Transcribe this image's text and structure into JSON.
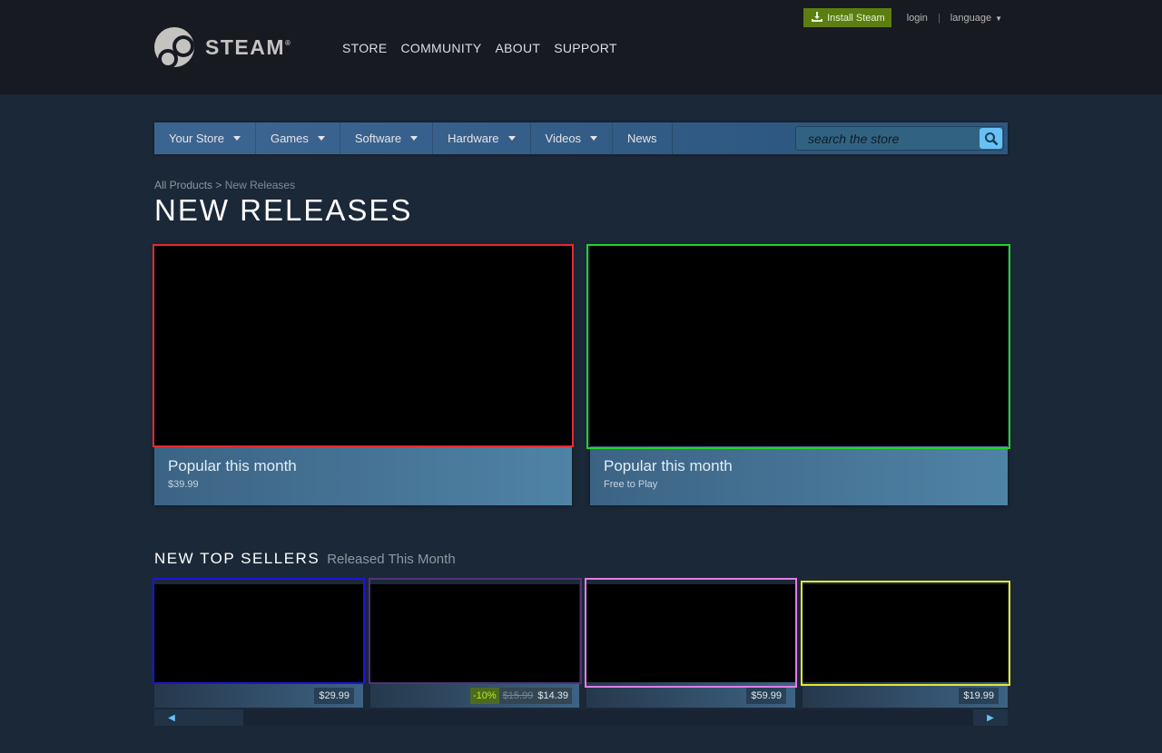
{
  "header": {
    "logo_text": "STEAM",
    "logo_reg": "®",
    "nav": [
      "STORE",
      "COMMUNITY",
      "ABOUT",
      "SUPPORT"
    ],
    "install_label": "Install Steam",
    "login_label": "login",
    "separator": "|",
    "language_label": "language"
  },
  "store_nav": {
    "tabs": [
      {
        "label": "Your Store"
      },
      {
        "label": "Games"
      },
      {
        "label": "Software"
      },
      {
        "label": "Hardware"
      },
      {
        "label": "Videos"
      },
      {
        "label": "News"
      }
    ],
    "search_placeholder": "search the store"
  },
  "breadcrumb": {
    "root": "All Products",
    "separator": ">",
    "current": "New Releases"
  },
  "page_title": "NEW RELEASES",
  "featured": [
    {
      "label": "Popular this month",
      "price": "$39.99"
    },
    {
      "label": "Popular this month",
      "price": "Free to Play"
    }
  ],
  "top_sellers": {
    "title": "NEW TOP SELLERS",
    "subtitle": "Released This Month",
    "items": [
      {
        "price": "$29.99"
      },
      {
        "discount": "-10%",
        "original_price": "$15.99",
        "final_price": "$14.39"
      },
      {
        "price": "$59.99"
      },
      {
        "price": "$19.99"
      }
    ]
  },
  "scroll": {
    "left_arrow": "◀",
    "right_arrow": "▶"
  },
  "colors": {
    "background": "#1b2838",
    "header_bg": "#171a21",
    "install_green": "#5c7e10",
    "accent_blue": "#67c1f5",
    "discount_green": "#4c6b22"
  }
}
